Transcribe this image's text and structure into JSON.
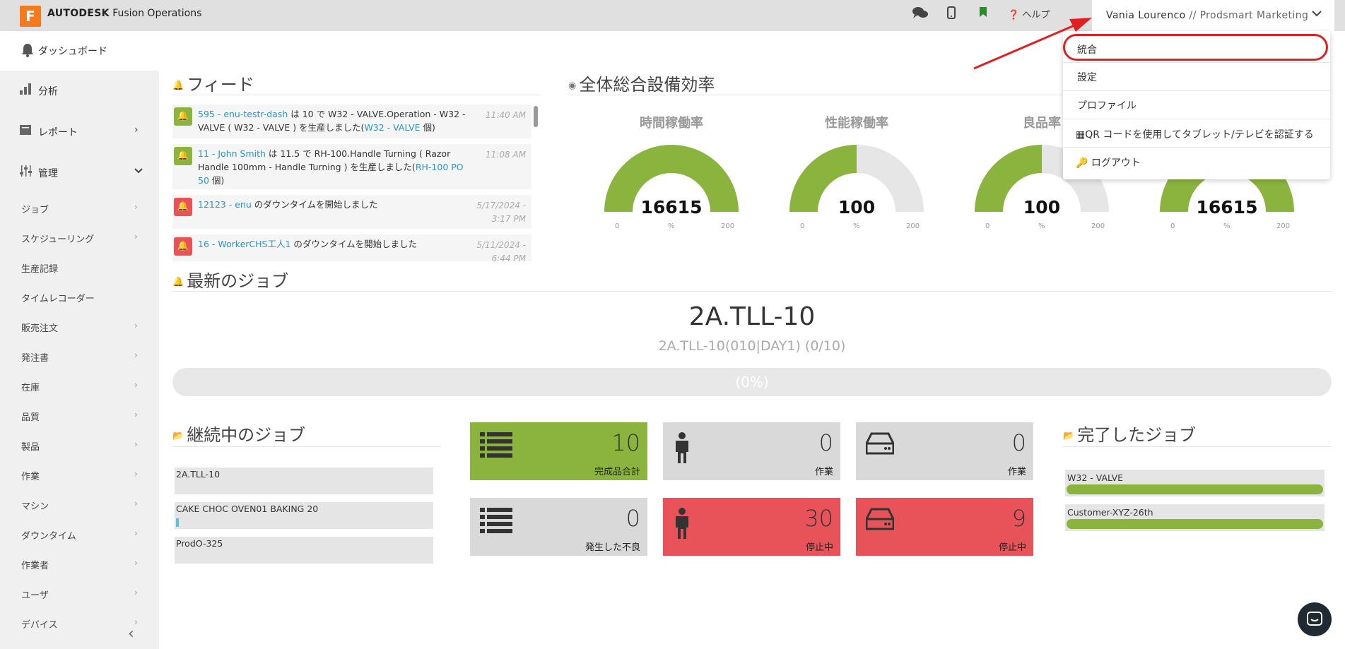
{
  "topbar": {
    "logo_letter": "F",
    "brand": "AUTODESK",
    "product": "Fusion Operations",
    "help": "ヘルプ",
    "user": "Vania Lourenco",
    "org": " // Prodsmart Marketing",
    "icons": [
      "comments-icon",
      "mobile-icon",
      "bookmark-icon",
      "question-icon",
      "chevron-down-icon"
    ]
  },
  "dashbar": {
    "label": "ダッシュボード"
  },
  "sidebar": {
    "main": [
      {
        "label": "分析",
        "icon": "bar-chart-icon"
      },
      {
        "label": "レポート",
        "icon": "book-icon"
      },
      {
        "label": "管理",
        "icon": "sliders-icon"
      }
    ],
    "sub": [
      "ジョブ",
      "スケジューリング",
      "生産記録",
      "タイムレコーダー",
      "販売注文",
      "発注書",
      "在庫",
      "品質",
      "製品",
      "作業",
      "マシン",
      "ダウンタイム",
      "作業者",
      "ユーザ",
      "デバイス"
    ]
  },
  "feed": {
    "title": "フィード",
    "items": [
      {
        "link1": "595 - enu-testr-dash",
        "text": " は 10 で W32 - VALVE.Operation - W32 - VALVE ( W32 - VALVE ) を生産しました(",
        "link2": "W32 - VALVE",
        "tail": " 個)",
        "time": "11:40 AM",
        "status": "green"
      },
      {
        "link1": "11 - John Smith",
        "text": " は 11.5 で RH-100.Handle Turning ( Razor Handle 100mm - Handle Turning ) を生産しました(",
        "link2": "RH-100 PO 50",
        "tail": " 個)",
        "time": "11:08 AM",
        "status": "green"
      },
      {
        "link1": "12123 - enu",
        "text": " のダウンタイムを開始しました",
        "link2": "",
        "tail": "",
        "time": "5/17/2024 - 3:17 PM",
        "status": "red"
      },
      {
        "link1": "16 - WorkerCHS工人1",
        "text": " のダウンタイムを開始しました",
        "link2": "",
        "tail": "",
        "time": "5/11/2024 - 6:44 PM",
        "status": "red"
      }
    ]
  },
  "oee": {
    "title": "全体総合設備効率",
    "gauges": [
      {
        "title": "時間稼働率",
        "value": "16615",
        "min": "0",
        "unit": "%",
        "max": "200",
        "fill": 1.0
      },
      {
        "title": "性能稼働率",
        "value": "100",
        "min": "0",
        "unit": "%",
        "max": "200",
        "fill": 0.5
      },
      {
        "title": "良品率",
        "value": "100",
        "min": "0",
        "unit": "%",
        "max": "200",
        "fill": 0.5
      },
      {
        "title": "",
        "value": "16615",
        "min": "0",
        "unit": "%",
        "max": "200",
        "fill": 1.0
      }
    ]
  },
  "latest_job": {
    "title": "最新のジョブ",
    "name": "2A.TLL-10",
    "sub": "2A.TLL-10(010|DAY1) (0/10)",
    "progress_text": "(0%)",
    "progress": 0
  },
  "ongoing": {
    "title": "継続中のジョブ",
    "items": [
      {
        "name": "2A.TLL-10",
        "progress": 0
      },
      {
        "name": "CAKE CHOC OVEN01 BAKING 20",
        "progress": 0.01
      },
      {
        "name": "ProdO-325",
        "progress": 0
      }
    ]
  },
  "tiles": [
    {
      "num": "10",
      "label": "完成品合計",
      "color": "green",
      "icon": "list-icon"
    },
    {
      "num": "0",
      "label": "作業",
      "color": "gray",
      "icon": "male-icon"
    },
    {
      "num": "0",
      "label": "作業",
      "color": "gray",
      "icon": "hdd-icon"
    },
    {
      "num": "0",
      "label": "発生した不良",
      "color": "gray",
      "icon": "list-icon"
    },
    {
      "num": "30",
      "label": "停止中",
      "color": "red",
      "icon": "male-icon"
    },
    {
      "num": "9",
      "label": "停止中",
      "color": "red",
      "icon": "hdd-icon"
    }
  ],
  "completed": {
    "title": "完了したジョブ",
    "items": [
      {
        "name": "W32 - VALVE",
        "progress": 1
      },
      {
        "name": "Customer-XYZ-26th",
        "progress": 1
      }
    ]
  },
  "dropdown": {
    "items": [
      "統合",
      "設定",
      "プロファイル",
      "QR コードを使用してタブレット/テレビを認証する",
      "ログアウト"
    ]
  },
  "colors": {
    "green": "#8bb43f",
    "red": "#e8535a",
    "gray": "#d9d9d9",
    "accent": "#f47a20",
    "link": "#2a94c9"
  }
}
